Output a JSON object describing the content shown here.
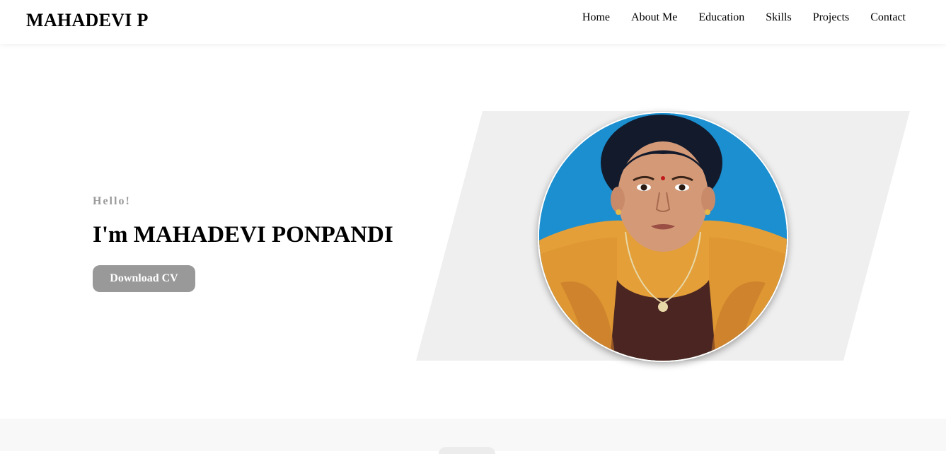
{
  "header": {
    "brand": "MAHADEVI P",
    "nav": [
      {
        "label": "Home"
      },
      {
        "label": "About Me"
      },
      {
        "label": "Education"
      },
      {
        "label": "Skills"
      },
      {
        "label": "Projects"
      },
      {
        "label": "Contact"
      }
    ]
  },
  "hero": {
    "greeting": "Hello!",
    "headline": "I'm MAHADEVI PONPANDI",
    "cv_button": "Download CV",
    "photo_icon": "profile-photo"
  },
  "colors": {
    "button_bg": "#999999",
    "greeting_text": "#9a9a9a",
    "parallelogram": "#efefef",
    "photo_background": "#1b8fd0",
    "footer_band": "#f8f8f8"
  }
}
